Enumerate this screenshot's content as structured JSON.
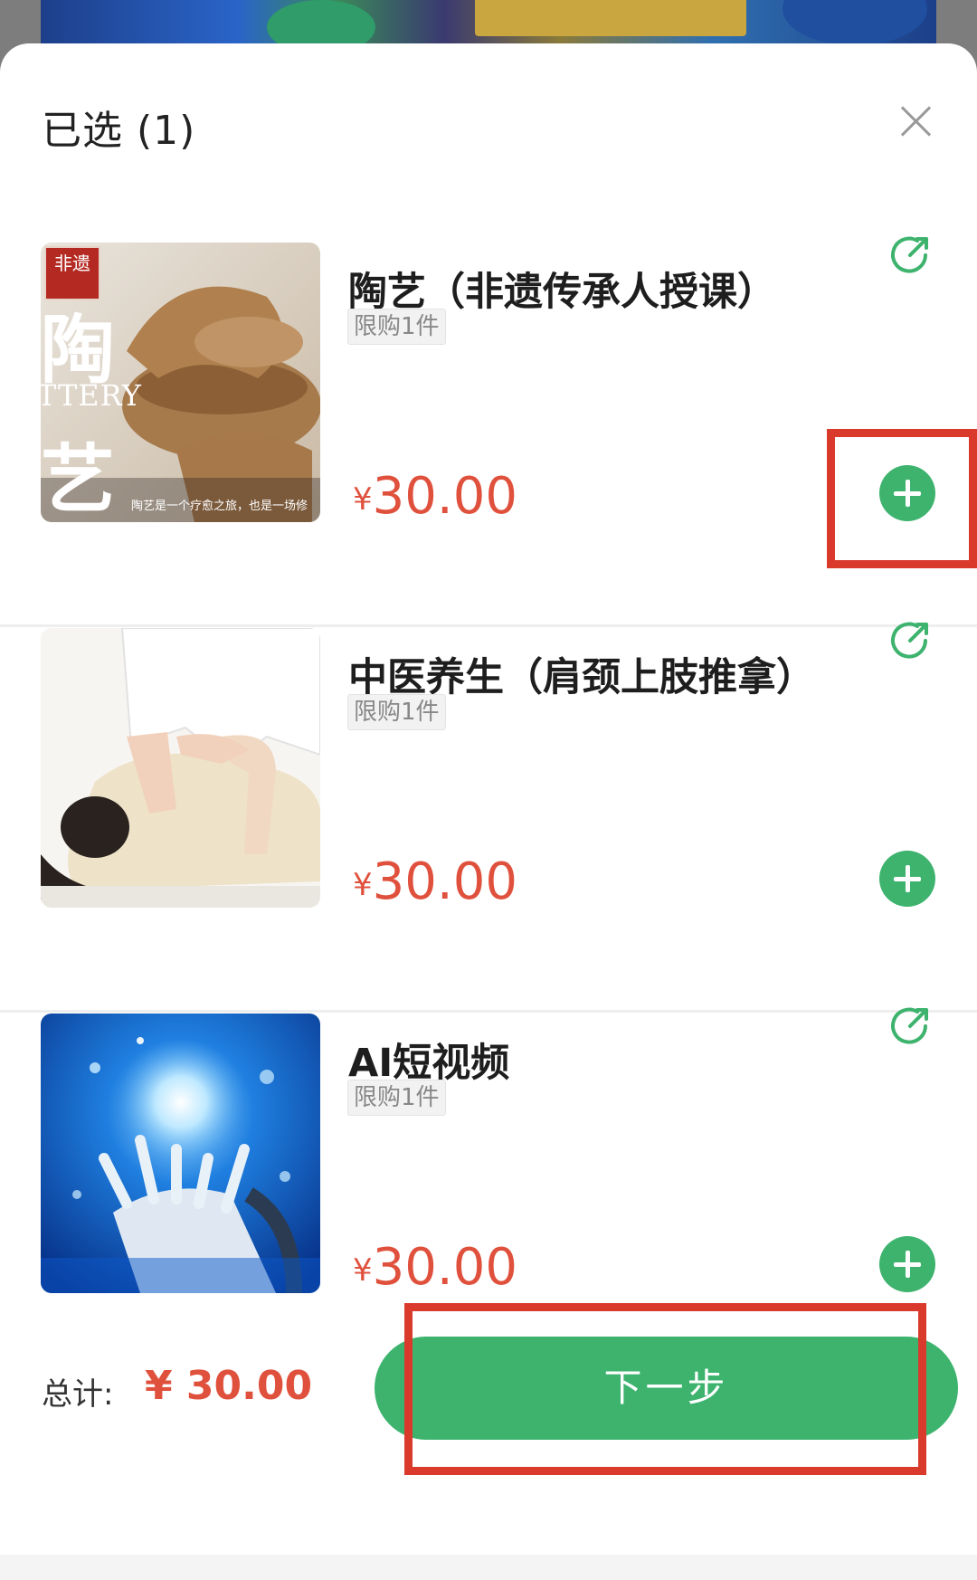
{
  "sheet": {
    "title": "已选 (1)"
  },
  "items": [
    {
      "name": "陶艺（非遗传承人授课）",
      "limit": "限购1件",
      "currency": "¥",
      "price": "30.00",
      "image_stamp": "非遗",
      "image_text_big": "陶",
      "image_text_en": "TTERY",
      "image_text_big2": "艺",
      "image_caption": "陶艺是一个疗愈之旅，也是一场修"
    },
    {
      "name": "中医养生（肩颈上肢推拿）",
      "limit": "限购1件",
      "currency": "¥",
      "price": "30.00"
    },
    {
      "name": "AI短视频",
      "limit": "限购1件",
      "currency": "¥",
      "price": "30.00"
    }
  ],
  "footer": {
    "total_label": "总计:",
    "total_value": "¥ 30.00",
    "next_label": "下一步"
  },
  "colors": {
    "accent_green": "#3db36e",
    "price_red": "#e0513d",
    "highlight_red": "#d93a2b"
  },
  "icons": {
    "close": "close-icon",
    "share": "share-icon",
    "add": "plus-icon"
  }
}
